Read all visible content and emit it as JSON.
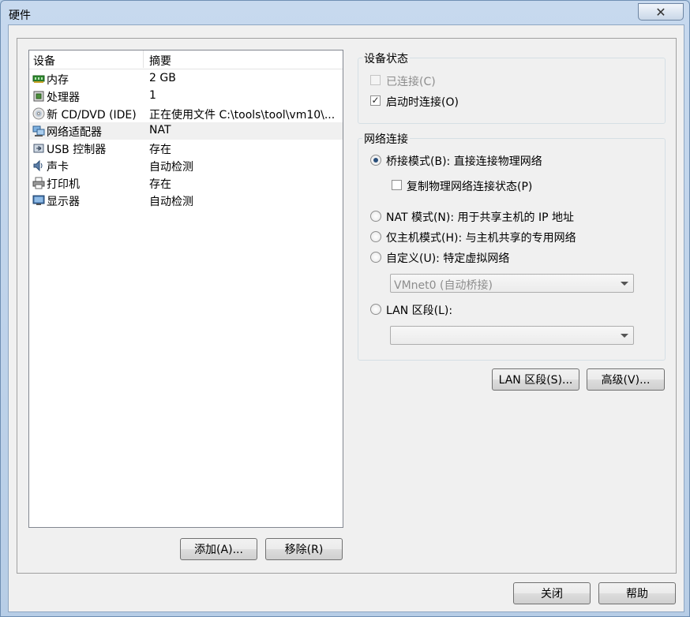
{
  "window": {
    "title": "硬件",
    "close_glyph": "✕"
  },
  "device_list": {
    "col_device": "设备",
    "col_summary": "摘要",
    "rows": [
      {
        "name": "内存",
        "summary": "2 GB",
        "icon": "memory-icon"
      },
      {
        "name": "处理器",
        "summary": "1",
        "icon": "processor-icon"
      },
      {
        "name": "新 CD/DVD (IDE)",
        "summary": "正在使用文件 C:\\tools\\tool\\vm10\\...",
        "icon": "cd-dvd-icon"
      },
      {
        "name": "网络适配器",
        "summary": "NAT",
        "icon": "network-adapter-icon",
        "selected": true
      },
      {
        "name": "USB 控制器",
        "summary": "存在",
        "icon": "usb-icon"
      },
      {
        "name": "声卡",
        "summary": "自动检测",
        "icon": "sound-card-icon"
      },
      {
        "name": "打印机",
        "summary": "存在",
        "icon": "printer-icon"
      },
      {
        "name": "显示器",
        "summary": "自动检测",
        "icon": "display-icon"
      }
    ],
    "add_button": "添加(A)...",
    "remove_button": "移除(R)"
  },
  "device_status": {
    "title": "设备状态",
    "connected_label": "已连接(C)",
    "connected_checked": false,
    "connected_disabled": true,
    "connect_at_power_on_label": "启动时连接(O)",
    "connect_at_power_on_checked": true
  },
  "network_connection": {
    "title": "网络连接",
    "bridged_label": "桥接模式(B): 直接连接物理网络",
    "replicate_label": "复制物理网络连接状态(P)",
    "nat_label": "NAT 模式(N): 用于共享主机的 IP 地址",
    "host_only_label": "仅主机模式(H): 与主机共享的专用网络",
    "custom_label": "自定义(U): 特定虚拟网络",
    "custom_value": "VMnet0 (自动桥接)",
    "lan_segment_label": "LAN 区段(L):",
    "lan_segment_value": "",
    "selected": "bridged"
  },
  "buttons": {
    "lan_segments": "LAN 区段(S)...",
    "advanced": "高级(V)...",
    "close": "关闭",
    "help": "帮助"
  }
}
